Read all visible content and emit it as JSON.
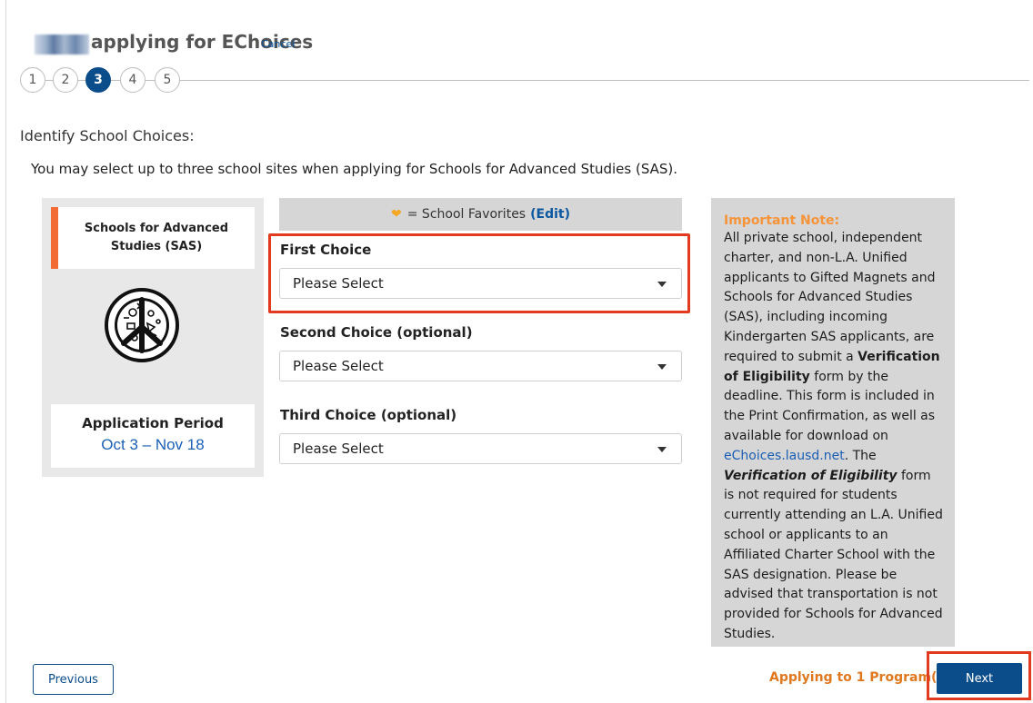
{
  "header": {
    "title": "applying for EChoices",
    "cancel_label": "Cancel"
  },
  "steps": [
    {
      "label": "1"
    },
    {
      "label": "2"
    },
    {
      "label": "3",
      "active": true
    },
    {
      "label": "4"
    },
    {
      "label": "5"
    }
  ],
  "section_title": "Identify School Choices:",
  "instructions": "You may select up to three school sites when applying for Schools for Advanced Studies (SAS).",
  "program": {
    "name": "Schools for Advanced Studies (SAS)",
    "logo_icon": "peace-sign-icon",
    "period_label": "Application Period",
    "period_dates": "Oct 3 – Nov 18"
  },
  "favorites": {
    "heart_icon": "heart-icon",
    "text": "= School Favorites",
    "edit_label": "(Edit)"
  },
  "choices": [
    {
      "label": "First Choice",
      "value": "Please Select"
    },
    {
      "label": "Second Choice (optional)",
      "value": "Please Select"
    },
    {
      "label": "Third Choice (optional)",
      "value": "Please Select"
    }
  ],
  "note": {
    "title": "Important Note:",
    "p1": "All private school, independent charter, and non-L.A. Unified applicants to Gifted Magnets and Schools for Advanced Studies (SAS), including incoming Kindergarten SAS applicants, are required to submit a",
    "b1": "Verification of Eligibility",
    "p2": "form by the deadline. This form is included in the Print Confirmation, as well as available for download on",
    "link": "eChoices.lausd.net",
    "p3": ". The",
    "b2": "Verification of Eligibility",
    "p4": "form is not required for students currently attending an L.A. Unified school or applicants to an Affiliated Charter School with the SAS designation. Please be advised that transportation is not provided for Schools for Advanced Studies."
  },
  "footer": {
    "previous_label": "Previous",
    "applying_prefix": "Applying to",
    "applying_count": "1",
    "applying_suffix": "Program(s)",
    "next_label": "Next"
  },
  "colors": {
    "primary": "#0b4d8a",
    "accent_orange": "#f26b35",
    "highlight_red": "#e23a1f"
  }
}
